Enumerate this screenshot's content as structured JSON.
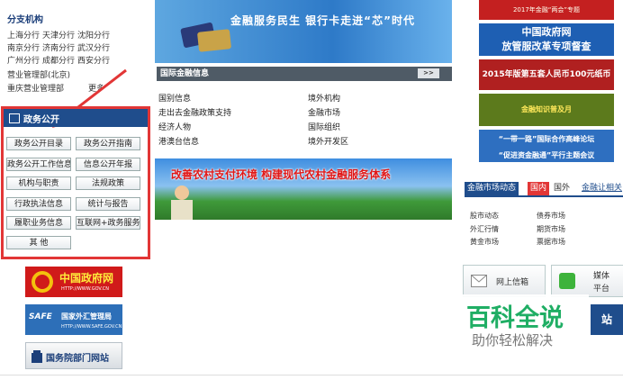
{
  "left": {
    "branch_title": "分支机构",
    "branch_rows": [
      [
        "上海分行",
        "天津分行",
        "沈阳分行"
      ],
      [
        "南京分行",
        "济南分行",
        "武汉分行"
      ],
      [
        "广州分行",
        "成都分行",
        "西安分行"
      ],
      [
        "营业管理部(北京)"
      ],
      [
        "重庆营业管理部"
      ]
    ],
    "more": "更多",
    "gov_title": "政务公开",
    "gov_buttons": [
      "政务公开目录",
      "政务公开指南",
      "政务公开工作信息",
      "信息公开年报",
      "机构与职责",
      "法规政策",
      "行政执法信息",
      "统计与报告",
      "履职业务信息",
      "互联网+政务服务",
      "其 他"
    ],
    "logo_gov": "中国政府网",
    "logo_gov_url": "HTTP://WWW.GOV.CN",
    "logo_safe": "国家外汇管理局",
    "logo_safe_badge": "SAFE",
    "logo_safe_url": "HTTP://WWW.SAFE.GOV.CN",
    "logo_state": "国务院部门网站"
  },
  "middle": {
    "banner_top_title": "金融服务民生  银行卡走进“芯”时代",
    "intl_title": "国际金融信息",
    "intl_more": ">>",
    "intl_col1": [
      "国别信息",
      "走出去金融政策支持",
      "经济人物",
      "港澳台信息"
    ],
    "intl_col2": [
      "境外机构",
      "金融市场",
      "国际组织",
      "境外开发区"
    ],
    "banner_mid_title": "改善农村支付环境  构建现代农村金融服务体系"
  },
  "right": {
    "rb1": "2017年金融“两会”专题",
    "rb2_line1": "中国政府网",
    "rb2_line2": "放管服改革专项督查",
    "rb3": "2015年版第五套人民币100元纸币",
    "rb4": "金融知识普及月",
    "rb5_line1": "“一带一路”国际合作高峰论坛",
    "rb5_line2": "“促进资金融通”平行主题会议",
    "mkt_tabs": [
      "金融市场动态",
      "国内",
      "国外",
      "金融让相关"
    ],
    "mkt_col1": [
      "股市动态",
      "外汇行情",
      "黄金市场"
    ],
    "mkt_col2": [
      "债券市场",
      "期货市场",
      "票据市场"
    ],
    "btn_letter": "网上信箱",
    "btn_media_line1": "媒体",
    "btn_media_line2": "平台",
    "btn_dark": "站"
  },
  "watermark": {
    "line1": "百科全说",
    "line2": "助你轻松解决"
  },
  "colors": {
    "accent_blue": "#1f4d8c",
    "highlight_red": "#e23636",
    "watermark_green": "#1fae64"
  }
}
